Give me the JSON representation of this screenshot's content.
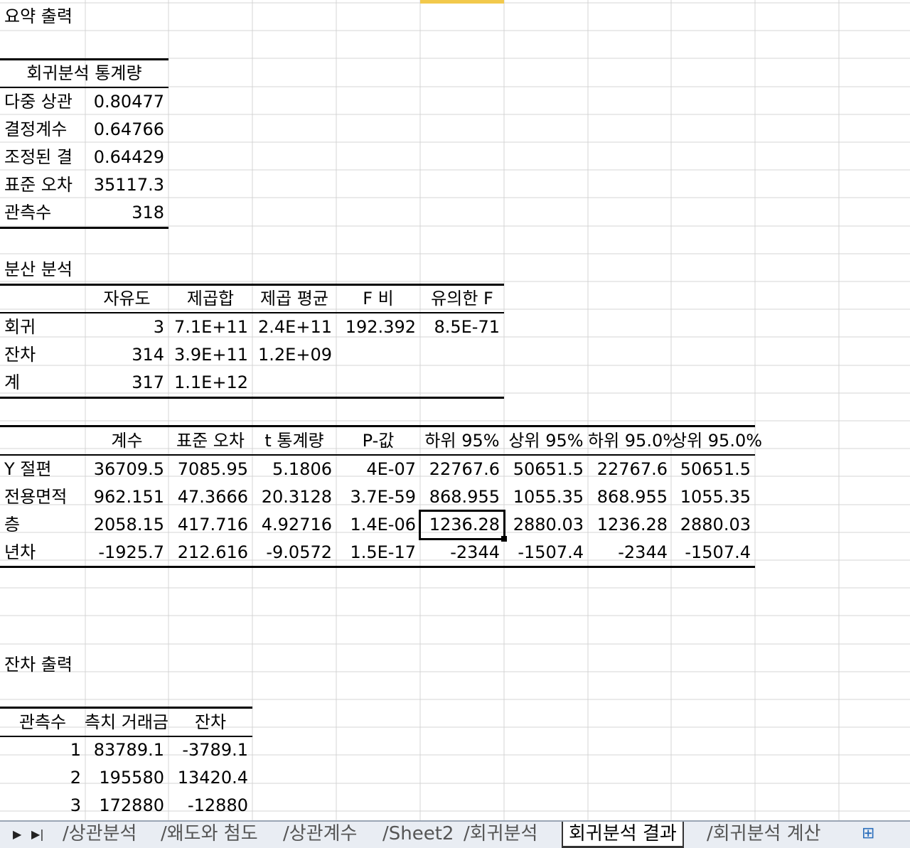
{
  "summary": {
    "title": "요약 출력",
    "reg_stats_header": "회귀분석 통계량",
    "reg_stats": [
      {
        "label": "다중 상관",
        "value": "0.80477"
      },
      {
        "label": "결정계수",
        "value": "0.64766"
      },
      {
        "label": "조정된 결",
        "value": "0.64429"
      },
      {
        "label": "표준 오차",
        "value": "35117.3"
      },
      {
        "label": "관측수",
        "value": "318"
      }
    ]
  },
  "anova": {
    "title": "분산 분석",
    "headers": [
      "자유도",
      "제곱합",
      "제곱 평균",
      "F 비",
      "유의한 F"
    ],
    "rows": [
      {
        "label": "회귀",
        "cells": [
          "3",
          "7.1E+11",
          "2.4E+11",
          "192.392",
          "8.5E-71"
        ]
      },
      {
        "label": "잔차",
        "cells": [
          "314",
          "3.9E+11",
          "1.2E+09",
          "",
          ""
        ]
      },
      {
        "label": "계",
        "cells": [
          "317",
          "1.1E+12",
          "",
          "",
          ""
        ]
      }
    ]
  },
  "coefficients": {
    "headers": [
      "계수",
      "표준 오차",
      "t 통계량",
      "P-값",
      "하위 95%",
      "상위 95%",
      "하위 95.0%",
      "상위 95.0%"
    ],
    "rows": [
      {
        "label": "Y 절편",
        "cells": [
          "36709.5",
          "7085.95",
          "5.1806",
          "4E-07",
          "22767.6",
          "50651.5",
          "22767.6",
          "50651.5"
        ]
      },
      {
        "label": "전용면적",
        "cells": [
          "962.151",
          "47.3666",
          "20.3128",
          "3.7E-59",
          "868.955",
          "1055.35",
          "868.955",
          "1055.35"
        ]
      },
      {
        "label": "층",
        "cells": [
          "2058.15",
          "417.716",
          "4.92716",
          "1.4E-06",
          "1236.28",
          "2880.03",
          "1236.28",
          "2880.03"
        ]
      },
      {
        "label": "년차",
        "cells": [
          "-1925.7",
          "212.616",
          "-9.0572",
          "1.5E-17",
          "-2344",
          "-1507.4",
          "-2344",
          "-1507.4"
        ]
      }
    ]
  },
  "residuals": {
    "title": "잔차 출력",
    "headers": [
      "관측수",
      "측치 거래금",
      "잔차"
    ],
    "rows": [
      [
        "1",
        "83789.1",
        "-3789.1"
      ],
      [
        "2",
        "195580",
        "13420.4"
      ],
      [
        "3",
        "172880",
        "-12880"
      ]
    ]
  },
  "tabs": {
    "nav_first": "▶",
    "nav_last": "▶|",
    "items": [
      "상관분석",
      "왜도와 첨도",
      "상관계수",
      "Sheet2",
      "회귀분석",
      "회귀분석 결과",
      "회귀분석 계산"
    ],
    "active_index": 5
  },
  "colors": {
    "grid": "#d4d4d4",
    "tabbar_bg": "#e9edf3",
    "selected_col_header": "#f2c94c"
  }
}
